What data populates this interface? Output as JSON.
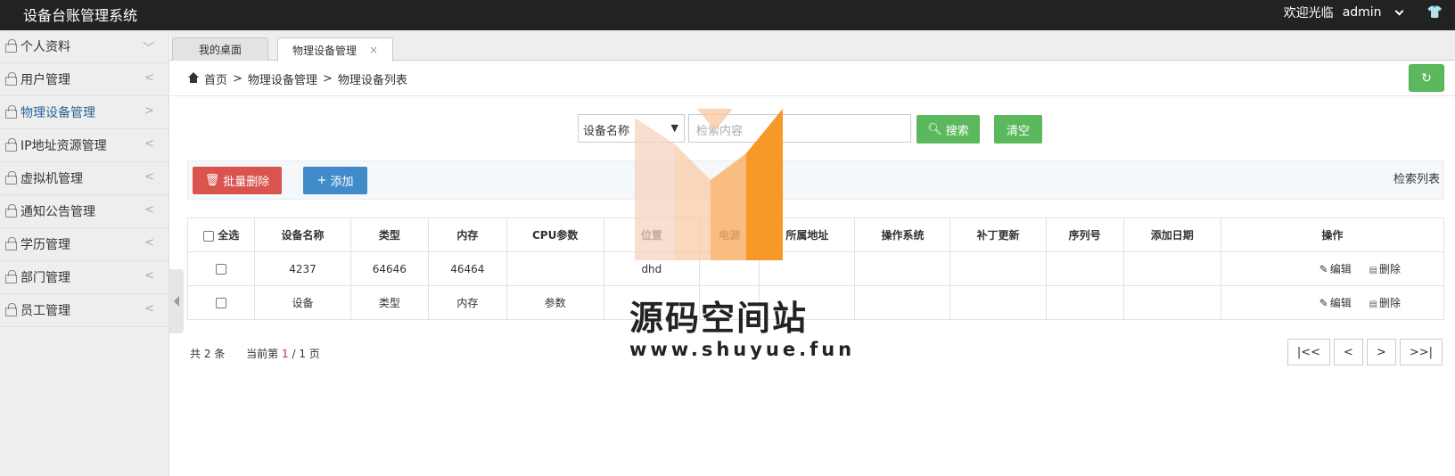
{
  "app": {
    "title": "设备台账管理系统",
    "welcome": "欢迎光临",
    "user": "admin"
  },
  "sidebar": {
    "items": [
      {
        "label": "个人资料",
        "arrow": "﹀",
        "active": false
      },
      {
        "label": "用户管理",
        "arrow": "<",
        "active": false
      },
      {
        "label": "物理设备管理",
        "arrow": ">",
        "active": true
      },
      {
        "label": "IP地址资源管理",
        "arrow": "<",
        "active": false
      },
      {
        "label": "虚拟机管理",
        "arrow": "<",
        "active": false
      },
      {
        "label": "通知公告管理",
        "arrow": "<",
        "active": false
      },
      {
        "label": "学历管理",
        "arrow": "<",
        "active": false
      },
      {
        "label": "部门管理",
        "arrow": "<",
        "active": false
      },
      {
        "label": "员工管理",
        "arrow": "<",
        "active": false
      }
    ]
  },
  "tabs": [
    {
      "label": "我的桌面"
    },
    {
      "label": "物理设备管理",
      "close": "×"
    }
  ],
  "breadcrumb": {
    "home": "首页",
    "sep": ">",
    "level1": "物理设备管理",
    "level2": "物理设备列表"
  },
  "search": {
    "field_selected": "设备名称",
    "placeholder": "检索内容",
    "search_label": "搜索",
    "clear_label": "清空"
  },
  "toolbar": {
    "batch_delete_label": "批量删除",
    "add_label": "添加",
    "list_label": "检索列表"
  },
  "table": {
    "headers": {
      "select_all": "全选",
      "name": "设备名称",
      "type": "类型",
      "memory": "内存",
      "cpu": "CPU参数",
      "location": "位置",
      "power": "电源",
      "ip": "所属地址",
      "os": "操作系统",
      "patch": "补丁更新",
      "serial": "序列号",
      "date": "添加日期",
      "actions": "操作"
    },
    "rows": [
      {
        "name": "4237",
        "type": "64646",
        "memory": "46464",
        "cpu": "",
        "location": "dhd",
        "power": "",
        "ip": "",
        "os": "",
        "patch": "",
        "serial": "",
        "date": ""
      },
      {
        "name": "设备",
        "type": "类型",
        "memory": "内存",
        "cpu": "参数",
        "location": "",
        "power": "",
        "ip": "",
        "os": "",
        "patch": "",
        "serial": "",
        "date": ""
      }
    ],
    "edit_label": "编辑",
    "delete_label": "删除"
  },
  "footer": {
    "total_prefix": "共",
    "total": "2",
    "total_suffix": "条",
    "current_prefix": "当前第",
    "current_page": "1",
    "pages": "/ 1",
    "page_suffix": "页"
  },
  "pager": {
    "first": "|<<",
    "prev": "<",
    "next": ">",
    "last": ">>|"
  },
  "watermark": {
    "text": "源码空间站",
    "url": "www.shuyue.fun"
  },
  "colors": {
    "topbar": "#222222",
    "success": "#5cb85c",
    "danger": "#d9534f",
    "primary": "#428bca",
    "watermark_orange": "#f7931e"
  }
}
